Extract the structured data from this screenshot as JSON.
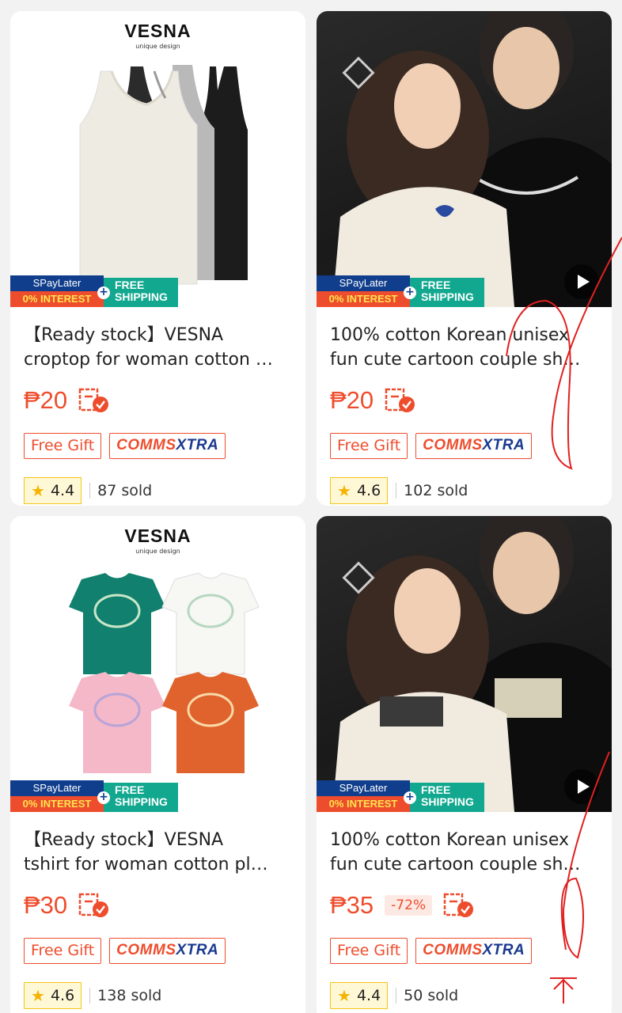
{
  "products": [
    {
      "brand_name": "VESNA",
      "brand_tagline": "unique design",
      "title_line1": "【Ready stock】VESNA",
      "title_line2": "croptop for woman cotton …",
      "price": "₱20",
      "discount": "",
      "tag_gift": "Free Gift",
      "tag_comms": "COMMS",
      "tag_xtra": "XTRA",
      "rating": "4.4",
      "sold": "87 sold",
      "has_video": false
    },
    {
      "brand_name": "",
      "brand_tagline": "",
      "title_line1": "100% cotton Korean unisex",
      "title_line2": "fun cute cartoon couple sh…",
      "price": "₱20",
      "discount": "",
      "tag_gift": "Free Gift",
      "tag_comms": "COMMS",
      "tag_xtra": "XTRA",
      "rating": "4.6",
      "sold": "102 sold",
      "has_video": true
    },
    {
      "brand_name": "VESNA",
      "brand_tagline": "unique design",
      "title_line1": "【Ready stock】VESNA",
      "title_line2": "tshirt for woman cotton pl…",
      "price": "₱30",
      "discount": "",
      "tag_gift": "Free Gift",
      "tag_comms": "COMMS",
      "tag_xtra": "XTRA",
      "rating": "4.6",
      "sold": "138 sold",
      "has_video": false
    },
    {
      "brand_name": "",
      "brand_tagline": "",
      "title_line1": "100% cotton Korean unisex",
      "title_line2": "fun cute cartoon couple sh…",
      "price": "₱35",
      "discount": "-72%",
      "tag_gift": "Free Gift",
      "tag_comms": "COMMS",
      "tag_xtra": "XTRA",
      "rating": "4.4",
      "sold": "50 sold",
      "has_video": true
    }
  ],
  "banner": {
    "spaylater": "SPayLater",
    "interest": "0% INTEREST",
    "free": "FREE",
    "shipping": "SHIPPING",
    "plus": "+"
  },
  "icons": {
    "star": "★",
    "play": "play-icon",
    "voucher": "voucher-icon"
  },
  "colors": {
    "accent": "#ee4d2d",
    "rating_star": "#f5b301",
    "comms_blue": "#1a3a8f",
    "annotation_red": "#e02020"
  }
}
